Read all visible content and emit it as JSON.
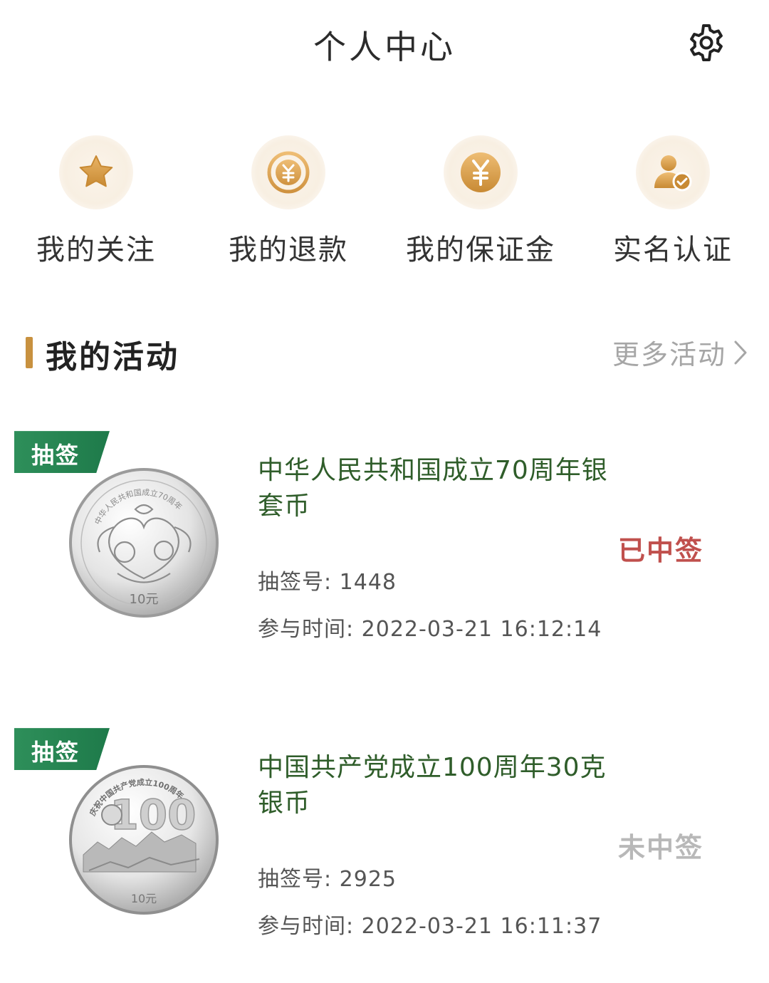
{
  "header": {
    "title": "个人中心",
    "settings_icon": "gear-icon"
  },
  "shortcuts": [
    {
      "label": "我的关注",
      "icon": "star-icon"
    },
    {
      "label": "我的退款",
      "icon": "refund-icon"
    },
    {
      "label": "我的保证金",
      "icon": "yen-icon"
    },
    {
      "label": "实名认证",
      "icon": "verified-user-icon"
    }
  ],
  "colors": {
    "gold": "#c8913f",
    "green": "#1e7a4a",
    "won": "#c0504d",
    "lost": "#b8b8b8",
    "title_green": "#2f5d2a"
  },
  "activities": {
    "section_title": "我的活动",
    "more_label": "更多活动",
    "items": [
      {
        "tag": "抽签",
        "title": "中华人民共和国成立70周年银套币",
        "status": "已中签",
        "status_color": "#c0504d",
        "lottery_label": "抽签号:",
        "lottery_no": "1448",
        "time_label": "参与时间:",
        "time": "2022-03-21 16:12:14",
        "coin_value": "10元"
      },
      {
        "tag": "抽签",
        "title": "中国共产党成立100周年30克银币",
        "status": "未中签",
        "status_color": "#b8b8b8",
        "lottery_label": "抽签号:",
        "lottery_no": "2925",
        "time_label": "参与时间:",
        "time": "2022-03-21 16:11:37",
        "coin_value": "10元"
      }
    ]
  }
}
